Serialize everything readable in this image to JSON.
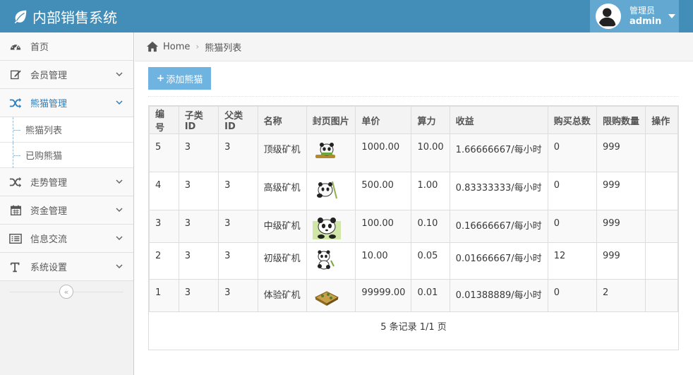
{
  "header": {
    "brand": "内部销售系统",
    "user_role": "管理员",
    "user_name": "admin"
  },
  "sidebar": {
    "items": [
      {
        "label": "首页"
      },
      {
        "label": "会员管理"
      },
      {
        "label": "熊猫管理"
      },
      {
        "label": "走势管理"
      },
      {
        "label": "资金管理"
      },
      {
        "label": "信息交流"
      },
      {
        "label": "系统设置"
      }
    ],
    "sub_items": [
      {
        "label": "熊猫列表"
      },
      {
        "label": "已购熊猫"
      }
    ]
  },
  "breadcrumb": {
    "home": "Home",
    "current": "熊猫列表"
  },
  "toolbar": {
    "add_label": "添加熊猫"
  },
  "table": {
    "headers": [
      "编号",
      "子类ID",
      "父类ID",
      "名称",
      "封页图片",
      "单价",
      "算力",
      "收益",
      "购买总数",
      "限购数量",
      "操作"
    ],
    "rows": [
      {
        "id": "5",
        "sub_id": "3",
        "parent_id": "3",
        "name": "顶级矿机",
        "price": "1000.00",
        "power": "10.00",
        "income": "1.66666667/每小时",
        "bought": "0",
        "limit": "999",
        "image": "panda-gold-icon"
      },
      {
        "id": "4",
        "sub_id": "3",
        "parent_id": "3",
        "name": "高级矿机",
        "price": "500.00",
        "power": "1.00",
        "income": "0.83333333/每小时",
        "bought": "0",
        "limit": "999",
        "image": "panda-bamboo-icon"
      },
      {
        "id": "3",
        "sub_id": "3",
        "parent_id": "3",
        "name": "中级矿机",
        "price": "100.00",
        "power": "0.10",
        "income": "0.16666667/每小时",
        "bought": "0",
        "limit": "999",
        "image": "panda-big-icon"
      },
      {
        "id": "2",
        "sub_id": "3",
        "parent_id": "3",
        "name": "初级矿机",
        "price": "10.00",
        "power": "0.05",
        "income": "0.01666667/每小时",
        "bought": "12",
        "limit": "999",
        "image": "panda-small-icon"
      },
      {
        "id": "1",
        "sub_id": "3",
        "parent_id": "3",
        "name": "体验矿机",
        "price": "99999.00",
        "power": "0.01",
        "income": "0.01388889/每小时",
        "bought": "0",
        "limit": "2",
        "image": "panda-basket-icon"
      }
    ],
    "footer": "5 条记录 1/1 页"
  },
  "colors": {
    "header": "#438eb9",
    "user_box": "#62a8d1",
    "accent": "#2b7dbc",
    "add_button": "#6fb3e0"
  }
}
